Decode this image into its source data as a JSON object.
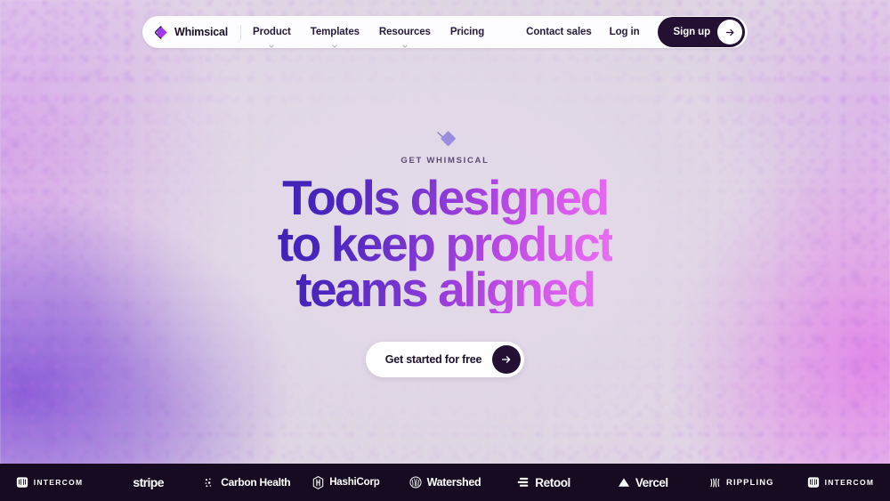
{
  "brand": {
    "name": "Whimsical",
    "logo_icon": "whimsical-diamond-icon",
    "accent_color": "#7c3aed"
  },
  "nav": {
    "links": [
      {
        "label": "Product",
        "has_caret": true
      },
      {
        "label": "Templates",
        "has_caret": true
      },
      {
        "label": "Resources",
        "has_caret": true
      },
      {
        "label": "Pricing",
        "has_caret": false
      }
    ],
    "contact_sales": "Contact sales",
    "log_in": "Log in",
    "sign_up": "Sign up",
    "sign_up_icon": "arrow-right-icon"
  },
  "hero": {
    "eyebrow_icon": "diamond-node-icon",
    "eyebrow": "GET  WHIMSICAL",
    "headline_lines": [
      "Tools designed",
      "to keep product",
      "teams aligned"
    ],
    "cta_label": "Get started for free",
    "cta_icon": "arrow-right-icon",
    "gradient_start": "#3f22b6",
    "gradient_end": "#ea72f2"
  },
  "logo_bar": {
    "background": "#170b22",
    "logos": [
      {
        "name": "Intercom",
        "label": "INTERCOM",
        "style": "caps",
        "glyph": "intercom-icon"
      },
      {
        "name": "Stripe",
        "label": "stripe",
        "style": "stripe",
        "glyph": "none"
      },
      {
        "name": "Carbon Health",
        "label": "Carbon Health",
        "style": "carbon",
        "glyph": "carbon-health-icon"
      },
      {
        "name": "HashiCorp",
        "label": "HashiCorp",
        "style": "hashi",
        "glyph": "hashicorp-icon"
      },
      {
        "name": "Watershed",
        "label": "Watershed",
        "style": "watershed",
        "glyph": "watershed-icon"
      },
      {
        "name": "Retool",
        "label": "Retool",
        "style": "retool",
        "glyph": "retool-icon"
      },
      {
        "name": "Vercel",
        "label": "Vercel",
        "style": "vercel",
        "glyph": "vercel-icon"
      },
      {
        "name": "Rippling",
        "label": "RIPPLING",
        "style": "rippling",
        "glyph": "rippling-icon"
      },
      {
        "name": "Intercom",
        "label": "INTERCOM",
        "style": "caps",
        "glyph": "intercom-icon"
      }
    ]
  }
}
